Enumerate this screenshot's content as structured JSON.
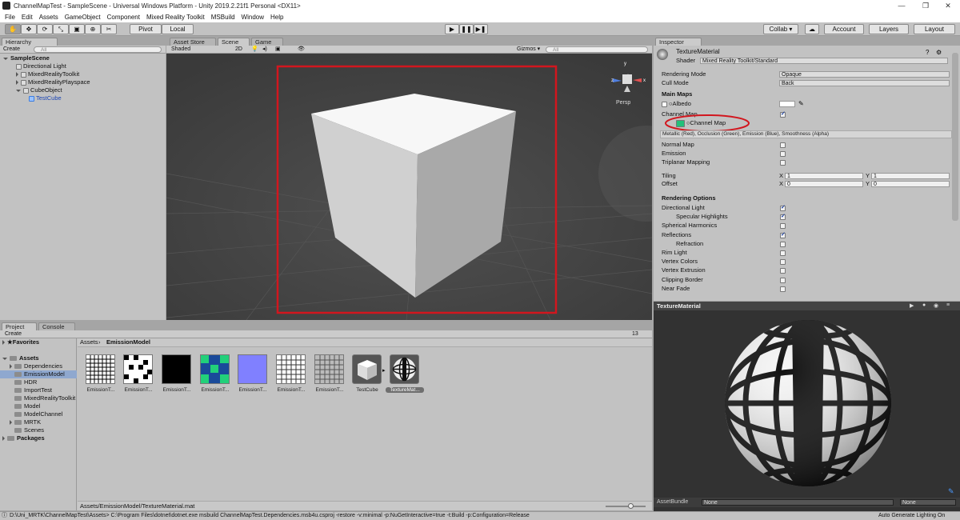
{
  "window": {
    "title": "ChannelMapTest - SampleScene - Universal Windows Platform - Unity 2019.2.21f1 Personal <DX11>"
  },
  "menu": [
    "File",
    "Edit",
    "Assets",
    "GameObject",
    "Component",
    "Mixed Reality Toolkit",
    "MSBuild",
    "Window",
    "Help"
  ],
  "toolbar": {
    "pivot": "Pivot",
    "local": "Local",
    "collab": "Collab ▾",
    "account": "Account",
    "layers": "Layers",
    "layout": "Layout"
  },
  "hierarchy": {
    "tab": "Hierarchy",
    "create": "Create",
    "search_placeholder": "All",
    "scene": "SampleScene",
    "items": [
      "Directional Light",
      "MixedRealityToolkit",
      "MixedRealityPlayspace",
      "CubeObject",
      "TestCube"
    ]
  },
  "scene": {
    "tabs": [
      "Asset Store",
      "Scene",
      "Game"
    ],
    "shading": "Shaded",
    "mode2d": "2D",
    "gizmos": "Gizmos ▾",
    "search_placeholder": "All",
    "persp": "Persp"
  },
  "inspector": {
    "tab": "Inspector",
    "material": "TextureMaterial",
    "shader_label": "Shader",
    "shader": "Mixed Reality Toolkit/Standard",
    "rendering_mode_label": "Rendering Mode",
    "rendering_mode": "Opaque",
    "cull_mode_label": "Cull Mode",
    "cull_mode": "Back",
    "main_maps": "Main Maps",
    "albedo": "Albedo",
    "channel_map_label": "Channel Map",
    "channel_map_slot": "Channel Map",
    "channel_hint": "Metallic (Red), Occlusion (Green), Emission (Blue), Smoothness (Alpha)",
    "normal_map": "Normal Map",
    "emission": "Emission",
    "triplanar": "Triplanar Mapping",
    "tiling": "Tiling",
    "offset": "Offset",
    "tiling_x": "1",
    "tiling_y": "1",
    "offset_x": "0",
    "offset_y": "0",
    "x": "X",
    "y": "Y",
    "rendering_options": "Rendering Options",
    "options": [
      {
        "label": "Directional Light",
        "on": true,
        "indent": false
      },
      {
        "label": "Specular Highlights",
        "on": true,
        "indent": true
      },
      {
        "label": "Spherical Harmonics",
        "on": false,
        "indent": false
      },
      {
        "label": "Reflections",
        "on": true,
        "indent": false
      },
      {
        "label": "Refraction",
        "on": false,
        "indent": true
      },
      {
        "label": "Rim Light",
        "on": false,
        "indent": false
      },
      {
        "label": "Vertex Colors",
        "on": false,
        "indent": false
      },
      {
        "label": "Vertex Extrusion",
        "on": false,
        "indent": false
      },
      {
        "label": "Clipping Border",
        "on": false,
        "indent": false
      },
      {
        "label": "Near Fade",
        "on": false,
        "indent": false
      }
    ],
    "preview_title": "TextureMaterial",
    "assetbundle_label": "AssetBundle",
    "assetbundle": "None",
    "assetbundle_variant": "None"
  },
  "project": {
    "tabs": [
      "Project",
      "Console"
    ],
    "create": "Create",
    "count": "13",
    "favorites": "Favorites",
    "assets": "Assets",
    "packages": "Packages",
    "folders": [
      "Dependencies",
      "EmissionModel",
      "HDR",
      "ImportTest",
      "MixedRealityToolkit",
      "Model",
      "ModelChannel",
      "MRTK",
      "Scenes"
    ],
    "breadcrumb": [
      "Assets",
      "EmissionModel"
    ],
    "files": [
      "EmissionT...",
      "EmissionT...",
      "EmissionT...",
      "EmissionT...",
      "EmissionT...",
      "EmissionT...",
      "EmissionT...",
      "TestCube",
      "TextureMat..."
    ],
    "path": "Assets/EmissionModel/TextureMaterial.mat"
  },
  "status": {
    "text": "D:\\Uni_MRTK\\ChannelMapTest\\Assets> C:\\Program Files\\dotnet\\dotnet.exe msbuild ChannelMapTest.Dependencies.msb4u.csproj -restore  -v:minimal -p:NuGetInteractive=true  -t:Build -p:Configuration=Release",
    "right": "Auto Generate Lighting On"
  },
  "colors": {
    "highlight_red": "#d2161e",
    "selection": "#3d80df",
    "channel_swatch": "#22c07a"
  }
}
